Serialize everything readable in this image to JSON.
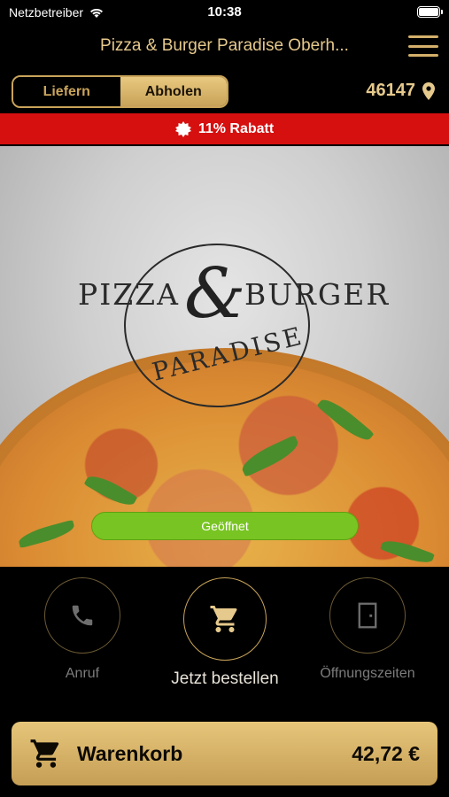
{
  "status_bar": {
    "carrier": "Netzbetreiber",
    "time": "10:38"
  },
  "header": {
    "title": "Pizza & Burger Paradise Oberh..."
  },
  "mode_toggle": {
    "options": [
      "Liefern",
      "Abholen"
    ],
    "selected": "Abholen"
  },
  "location": {
    "zip": "46147"
  },
  "promo": {
    "text": "11% Rabatt"
  },
  "logo": {
    "word_left": "PIZZA",
    "ampersand": "&",
    "word_right": "BURGER",
    "word_bottom": "PARADISE"
  },
  "hero": {
    "status": "Geöffnet"
  },
  "actions": {
    "call": "Anruf",
    "order": "Jetzt bestellen",
    "hours": "Öffnungszeiten"
  },
  "cart": {
    "label": "Warenkorb",
    "total": "42,72 €"
  },
  "colors": {
    "gold": "#c9a45a",
    "promo_red": "#d60f0f",
    "open_green": "#78c422"
  }
}
